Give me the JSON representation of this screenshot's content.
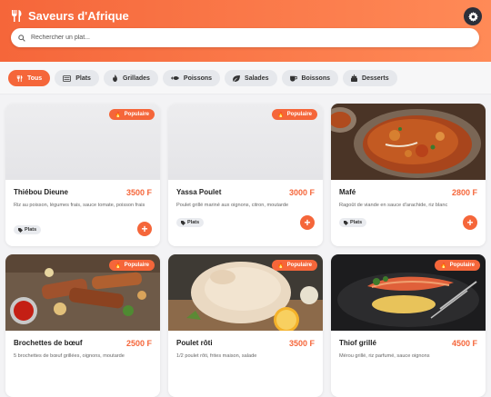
{
  "app": {
    "title": "Saveurs d'Afrique"
  },
  "search": {
    "placeholder": "Rechercher un plat..."
  },
  "tabs": [
    {
      "label": "Tous",
      "icon": "utensils-icon"
    },
    {
      "label": "Plats",
      "icon": "plate-icon"
    },
    {
      "label": "Grillades",
      "icon": "fire-icon"
    },
    {
      "label": "Poissons",
      "icon": "fish-icon"
    },
    {
      "label": "Salades",
      "icon": "leaf-icon"
    },
    {
      "label": "Boissons",
      "icon": "cup-icon"
    },
    {
      "label": "Desserts",
      "icon": "cake-icon"
    }
  ],
  "badge_label": "Populaire",
  "cards": [
    {
      "name": "Thiébou Dieune",
      "price": "3500 F",
      "desc": "Riz au poisson, légumes frais, sauce tomate, poisson frais",
      "tag": "Plats",
      "popular": true
    },
    {
      "name": "Yassa Poulet",
      "price": "3000 F",
      "desc": "Poulet grillé mariné aux oignons, citron, moutarde",
      "tag": "Plats",
      "popular": true
    },
    {
      "name": "Mafé",
      "price": "2800 F",
      "desc": "Ragoût de viande en sauce d'arachide, riz blanc",
      "tag": "Plats",
      "popular": false
    },
    {
      "name": "Brochettes de bœuf",
      "price": "2500 F",
      "desc": "5 brochettes de bœuf grillées, oignons, moutarde",
      "tag": "",
      "popular": true
    },
    {
      "name": "Poulet rôti",
      "price": "3500 F",
      "desc": "1/2 poulet rôti, frites maison, salade",
      "tag": "",
      "popular": true
    },
    {
      "name": "Thiof grillé",
      "price": "4500 F",
      "desc": "Mérou grillé, riz parfumé, sauce oignons",
      "tag": "",
      "popular": true
    }
  ],
  "colors": {
    "accent": "#f5663a",
    "dark": "#2b2f3a"
  }
}
